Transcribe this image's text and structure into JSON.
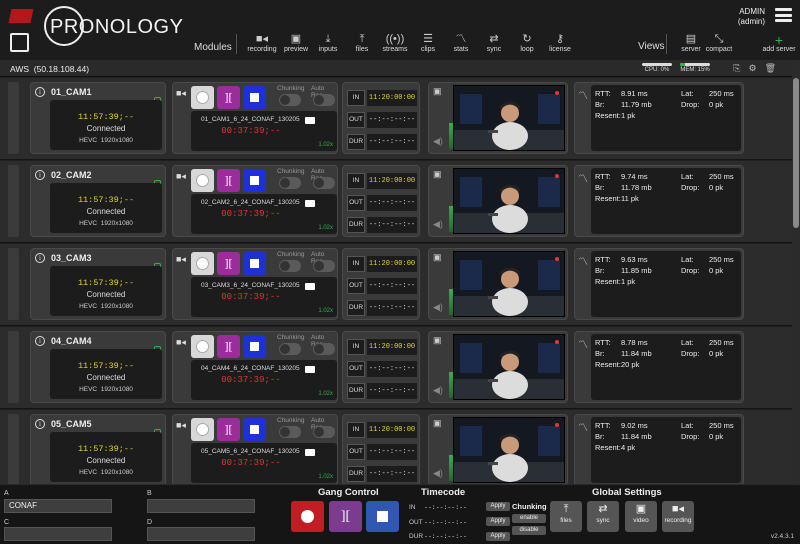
{
  "header": {
    "logo_text": "PRONOLOGY",
    "modules_label": "Modules",
    "views_label": "Views",
    "modules": [
      {
        "label": "recording",
        "icon": "camera-icon"
      },
      {
        "label": "preview",
        "icon": "preview-icon"
      },
      {
        "label": "inputs",
        "icon": "download-icon"
      },
      {
        "label": "files",
        "icon": "upload-icon"
      },
      {
        "label": "streams",
        "icon": "broadcast-icon"
      },
      {
        "label": "clips",
        "icon": "list-icon"
      },
      {
        "label": "stats",
        "icon": "signal-icon"
      },
      {
        "label": "sync",
        "icon": "sync-icon"
      },
      {
        "label": "loop",
        "icon": "loop-icon"
      },
      {
        "label": "license",
        "icon": "key-icon"
      }
    ],
    "views": [
      {
        "label": "server",
        "icon": "server-icon"
      },
      {
        "label": "compact",
        "icon": "compact-icon"
      }
    ],
    "admin_name": "ADMIN",
    "admin_role": "(admin)",
    "add_server_label": "add server"
  },
  "server": {
    "name": "AWS",
    "ip": "(50.18.108.44)",
    "cpu_label": "CPU: 0%",
    "cpu_fraction": 0.0,
    "mem_label": "MEM: 15%",
    "mem_fraction": 0.15
  },
  "channels": [
    {
      "name": "01_CAM1",
      "timecode": "11:57:39;--",
      "status": "Connected",
      "codec": "HEVC",
      "resolution": "1920x1080",
      "file": "01_CAM1_6_24_CONAF_130205",
      "rec_tc": "00:37:39;--",
      "speed": "1.02x",
      "chunking_label": "Chunking",
      "autorec_label": "Auto Rec",
      "in_label": "IN",
      "in_tc": "11:20:00:00",
      "out_label": "OUT",
      "out_tc": "--:--:--:--",
      "dur_label": "DUR",
      "dur_tc": "--:--:--:--",
      "rtt_label": "RTT:",
      "rtt": "8.91 ms",
      "br_label": "Br:",
      "br": "11.79 mb",
      "resent_label": "Resent:",
      "resent": "1 pk",
      "lat_label": "Lat:",
      "lat": "250 ms",
      "drop_label": "Drop:",
      "drop": "0 pk"
    },
    {
      "name": "02_CAM2",
      "timecode": "11:57:39;--",
      "status": "Connected",
      "codec": "HEVC",
      "resolution": "1920x1080",
      "file": "02_CAM2_6_24_CONAF_130205",
      "rec_tc": "00:37:39;--",
      "speed": "1.02x",
      "chunking_label": "Chunking",
      "autorec_label": "Auto Rec",
      "in_label": "IN",
      "in_tc": "11:20:00:00",
      "out_label": "OUT",
      "out_tc": "--:--:--:--",
      "dur_label": "DUR",
      "dur_tc": "--:--:--:--",
      "rtt_label": "RTT:",
      "rtt": "9.74 ms",
      "br_label": "Br:",
      "br": "11.78 mb",
      "resent_label": "Resent:",
      "resent": "11 pk",
      "lat_label": "Lat:",
      "lat": "250 ms",
      "drop_label": "Drop:",
      "drop": "0 pk"
    },
    {
      "name": "03_CAM3",
      "timecode": "11:57:39;--",
      "status": "Connected",
      "codec": "HEVC",
      "resolution": "1920x1080",
      "file": "03_CAM3_6_24_CONAF_130205",
      "rec_tc": "00:37:39;--",
      "speed": "1.02x",
      "chunking_label": "Chunking",
      "autorec_label": "Auto Rec",
      "in_label": "IN",
      "in_tc": "11:20:00:00",
      "out_label": "OUT",
      "out_tc": "--:--:--:--",
      "dur_label": "DUR",
      "dur_tc": "--:--:--:--",
      "rtt_label": "RTT:",
      "rtt": "9.63 ms",
      "br_label": "Br:",
      "br": "11.85 mb",
      "resent_label": "Resent:",
      "resent": "1 pk",
      "lat_label": "Lat:",
      "lat": "250 ms",
      "drop_label": "Drop:",
      "drop": "0 pk"
    },
    {
      "name": "04_CAM4",
      "timecode": "11:57:39;--",
      "status": "Connected",
      "codec": "HEVC",
      "resolution": "1920x1080",
      "file": "04_CAM4_6_24_CONAF_130205",
      "rec_tc": "00:37:39;--",
      "speed": "1.02x",
      "chunking_label": "Chunking",
      "autorec_label": "Auto Rec",
      "in_label": "IN",
      "in_tc": "11:20:00:00",
      "out_label": "OUT",
      "out_tc": "--:--:--:--",
      "dur_label": "DUR",
      "dur_tc": "--:--:--:--",
      "rtt_label": "RTT:",
      "rtt": "8.78 ms",
      "br_label": "Br:",
      "br": "11.84 mb",
      "resent_label": "Resent:",
      "resent": "20 pk",
      "lat_label": "Lat:",
      "lat": "250 ms",
      "drop_label": "Drop:",
      "drop": "0 pk"
    },
    {
      "name": "05_CAM5",
      "timecode": "11:57:39;--",
      "status": "Connected",
      "codec": "HEVC",
      "resolution": "1920x1080",
      "file": "05_CAM5_6_24_CONAF_130205",
      "rec_tc": "00:37:39;--",
      "speed": "1.02x",
      "chunking_label": "Chunking",
      "autorec_label": "Auto Rec",
      "in_label": "IN",
      "in_tc": "11:20:00:00",
      "out_label": "OUT",
      "out_tc": "--:--:--:--",
      "dur_label": "DUR",
      "dur_tc": "--:--:--:--",
      "rtt_label": "RTT:",
      "rtt": "9.02 ms",
      "br_label": "Br:",
      "br": "11.84 mb",
      "resent_label": "Resent:",
      "resent": "4 pk",
      "lat_label": "Lat:",
      "lat": "250 ms",
      "drop_label": "Drop:",
      "drop": "0 pk"
    }
  ],
  "bottom": {
    "a_label": "A",
    "a_value": "CONAF",
    "b_label": "B",
    "b_value": "",
    "c_label": "C",
    "c_value": "",
    "d_label": "D",
    "d_value": "",
    "gang_title": "Gang Control",
    "timecode_title": "Timecode",
    "in_label": "IN",
    "in_tc": "--:--:--:--",
    "out_label": "OUT",
    "out_tc": "--:--:--:--",
    "dur_label": "DUR",
    "dur_tc": "--:--:--:--",
    "apply_label": "Apply",
    "chunking_title": "Chunking",
    "enable_label": "enable",
    "disable_label": "disable",
    "global_title": "Global Settings",
    "global_buttons": [
      {
        "label": "files",
        "icon": "upload-icon"
      },
      {
        "label": "sync",
        "icon": "sync-icon"
      },
      {
        "label": "video",
        "icon": "preview-icon"
      },
      {
        "label": "recording",
        "icon": "camera-icon"
      }
    ],
    "version": "v2.4.3.1"
  },
  "colors": {
    "record": "#c01d25",
    "pause": "#7b3b8e",
    "stop": "#2f57b3",
    "timecode_yellow": "#e0d43a",
    "rec_red": "#e83232",
    "ok_green": "#2fb34a"
  }
}
